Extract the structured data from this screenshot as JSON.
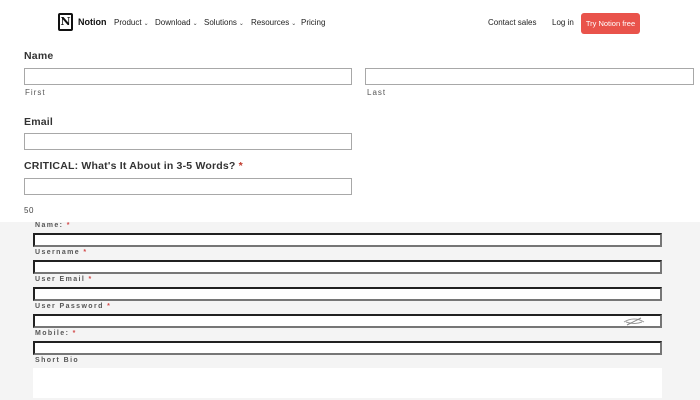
{
  "nav": {
    "brand": "Notion",
    "logo_letter": "N",
    "items": [
      {
        "label": "Product",
        "caret": "⌄"
      },
      {
        "label": "Download",
        "caret": "⌄"
      },
      {
        "label": "Solutions",
        "caret": "⌄"
      },
      {
        "label": "Resources",
        "caret": "⌄"
      },
      {
        "label": "Pricing",
        "caret": ""
      }
    ],
    "contact_sales": "Contact sales",
    "log_in": "Log in",
    "cta": "Try Notion free",
    "cta_color": "#e9534b"
  },
  "form": {
    "name_label": "Name",
    "first_sublabel": "First",
    "last_sublabel": "Last",
    "first_value": "",
    "last_value": "",
    "email_label": "Email",
    "email_value": "",
    "critical_label": "CRITICAL: What's It About in 3-5 Words?",
    "required_mark": "*",
    "critical_value": "",
    "char_count": "50"
  },
  "registration": {
    "name_label": "Name:",
    "username_label": "Username",
    "email_label": "User Email",
    "password_label": "User Password",
    "mobile_label": "Mobile:",
    "bio_label": "Short Bio",
    "required_mark": "*",
    "required_color": "#d34a4a"
  }
}
